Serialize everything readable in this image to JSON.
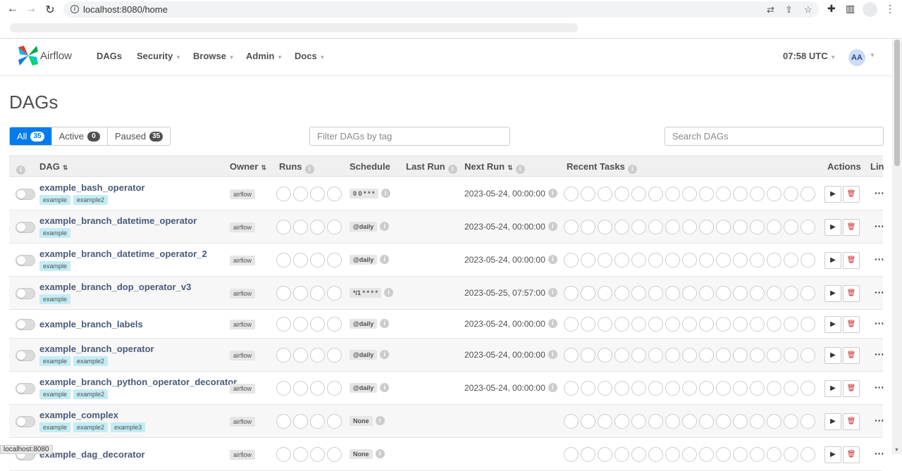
{
  "browser": {
    "url": "localhost:8080/home",
    "status_text": "localhost:8080"
  },
  "nav": {
    "brand": "Airflow",
    "menu": [
      "DAGs",
      "Security",
      "Browse",
      "Admin",
      "Docs"
    ],
    "time": "07:58 UTC",
    "avatar": "AA"
  },
  "page": {
    "title": "DAGs",
    "filters": [
      {
        "label": "All",
        "count": "35"
      },
      {
        "label": "Active",
        "count": "0"
      },
      {
        "label": "Paused",
        "count": "35"
      }
    ],
    "tag_filter_placeholder": "Filter DAGs by tag",
    "search_placeholder": "Search DAGs"
  },
  "table": {
    "headers": {
      "dag": "DAG",
      "owner": "Owner",
      "runs": "Runs",
      "schedule": "Schedule",
      "last_run": "Last Run",
      "next_run": "Next Run",
      "recent_tasks": "Recent Tasks",
      "actions": "Actions",
      "links": "Lin"
    },
    "rows": [
      {
        "dag_id": "example_bash_operator",
        "tags": [
          "example",
          "example2"
        ],
        "owner": "airflow",
        "schedule": "0 0 * * *",
        "next_run": "2023-05-24, 00:00:00"
      },
      {
        "dag_id": "example_branch_datetime_operator",
        "tags": [
          "example"
        ],
        "owner": "airflow",
        "schedule": "@daily",
        "next_run": "2023-05-24, 00:00:00"
      },
      {
        "dag_id": "example_branch_datetime_operator_2",
        "tags": [
          "example"
        ],
        "owner": "airflow",
        "schedule": "@daily",
        "next_run": "2023-05-24, 00:00:00"
      },
      {
        "dag_id": "example_branch_dop_operator_v3",
        "tags": [
          "example"
        ],
        "owner": "airflow",
        "schedule": "*/1 * * * *",
        "next_run": "2023-05-25, 07:57:00"
      },
      {
        "dag_id": "example_branch_labels",
        "tags": [],
        "owner": "airflow",
        "schedule": "@daily",
        "next_run": "2023-05-24, 00:00:00"
      },
      {
        "dag_id": "example_branch_operator",
        "tags": [
          "example",
          "example2"
        ],
        "owner": "airflow",
        "schedule": "@daily",
        "next_run": "2023-05-24, 00:00:00"
      },
      {
        "dag_id": "example_branch_python_operator_decorator",
        "tags": [
          "example",
          "example2"
        ],
        "owner": "airflow",
        "schedule": "@daily",
        "next_run": "2023-05-24, 00:00:00"
      },
      {
        "dag_id": "example_complex",
        "tags": [
          "example",
          "example2",
          "example3"
        ],
        "owner": "airflow",
        "schedule": "None",
        "next_run": ""
      },
      {
        "dag_id": "example_dag_decorator",
        "tags": [],
        "owner": "airflow",
        "schedule": "None",
        "next_run": ""
      }
    ]
  },
  "colors": {
    "accent": "#017cee",
    "tag_bg": "#c3ecf4",
    "delete": "#c9302c"
  }
}
